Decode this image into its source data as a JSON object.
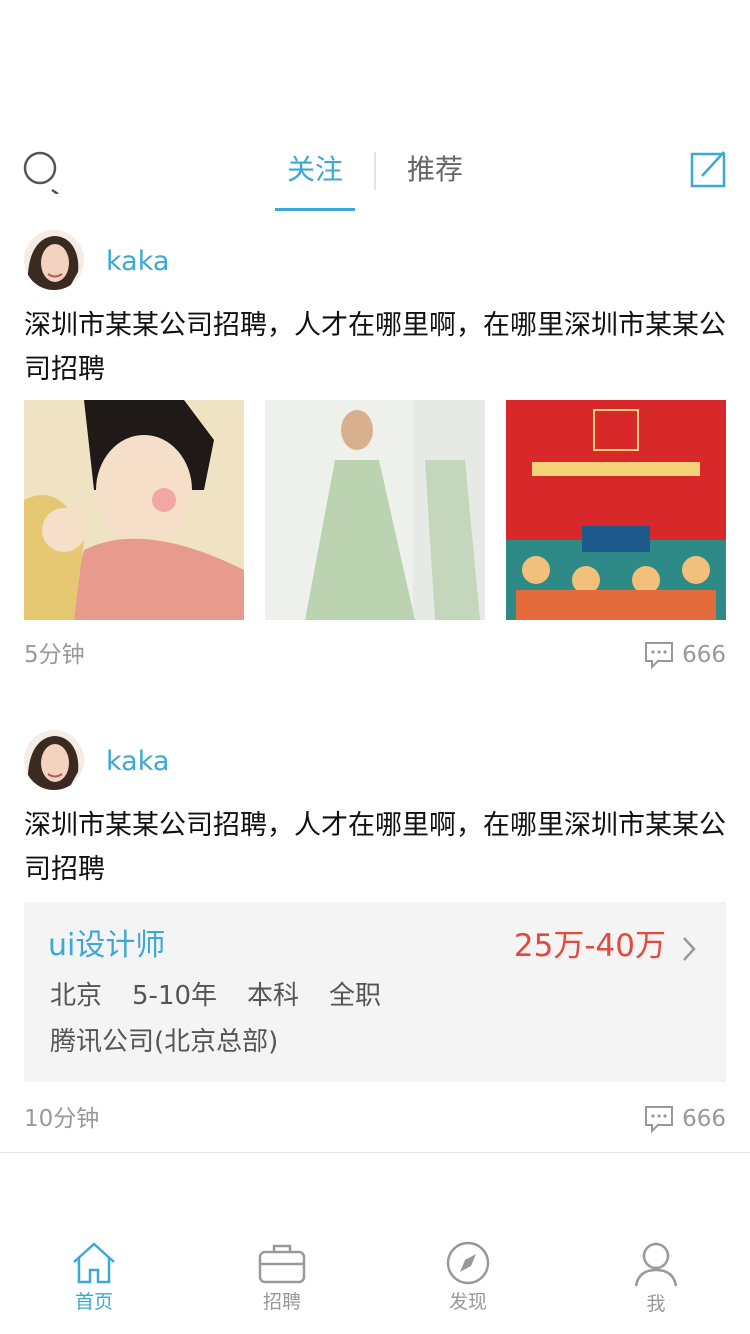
{
  "header": {
    "tabs": [
      {
        "label": "关注",
        "active": true
      },
      {
        "label": "推荐",
        "active": false
      }
    ]
  },
  "posts": [
    {
      "username": "kaka",
      "text": "深圳市某某公司招聘，人才在哪里啊，在哪里深圳市某某公司招聘",
      "images": [
        "painting-thumbnail",
        "green-dress-thumbnail",
        "red-poster-thumbnail"
      ],
      "time": "5分钟",
      "comments": "666"
    },
    {
      "username": "kaka",
      "text": "深圳市某某公司招聘，人才在哪里啊，在哪里深圳市某某公司招聘",
      "job": {
        "title": "ui设计师",
        "salary": "25万-40万",
        "city": "北京",
        "experience": "5-10年",
        "education": "本科",
        "type": "全职",
        "company": "腾讯公司(北京总部)"
      },
      "time": "10分钟",
      "comments": "666"
    }
  ],
  "tabbar": [
    {
      "label": "首页",
      "icon": "home-icon",
      "active": true
    },
    {
      "label": "招聘",
      "icon": "briefcase-icon",
      "active": false
    },
    {
      "label": "发现",
      "icon": "compass-icon",
      "active": false
    },
    {
      "label": "我",
      "icon": "user-icon",
      "active": false
    }
  ],
  "colors": {
    "accent": "#3ba8d6",
    "salary": "#e24a3d",
    "muted": "#999999"
  }
}
